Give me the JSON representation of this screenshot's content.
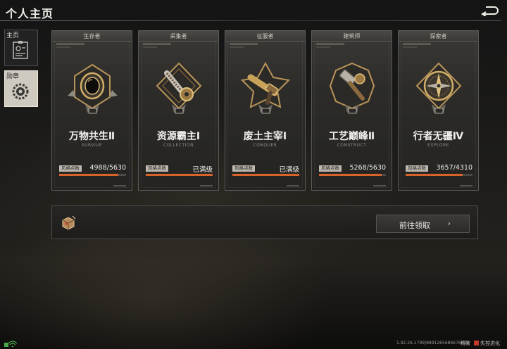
{
  "header": {
    "title": "个人主页"
  },
  "sidebar": {
    "items": [
      {
        "label": "主页",
        "icon": "profile-card-icon",
        "active": false
      },
      {
        "label": "勋章",
        "icon": "gear-badge-icon",
        "active": true
      }
    ]
  },
  "cards": [
    {
      "role": "生存者",
      "name": "万物共生Ⅱ",
      "subtitle": "SURVIVE",
      "points_label": "风格点数",
      "points": "4988/5630",
      "progress": 0.886,
      "medal": "astronaut-helmet-medal-icon",
      "rank": "Ⅱ"
    },
    {
      "role": "采集者",
      "name": "资源霸主Ⅰ",
      "subtitle": "COLLECTION",
      "points_label": "风格点数",
      "points": "已满级",
      "progress": 1.0,
      "medal": "chainsaw-medal-icon",
      "rank": "Ⅰ"
    },
    {
      "role": "征服者",
      "name": "废土主宰Ⅰ",
      "subtitle": "CONQUER",
      "points_label": "风格点数",
      "points": "已满级",
      "progress": 1.0,
      "medal": "revolver-medal-icon",
      "rank": "Ⅰ"
    },
    {
      "role": "建筑师",
      "name": "工艺巅峰Ⅱ",
      "subtitle": "CONSTRUCT",
      "points_label": "风格点数",
      "points": "5268/5630",
      "progress": 0.936,
      "medal": "hammer-medal-icon",
      "rank": "Ⅱ"
    },
    {
      "role": "探索者",
      "name": "行者无疆Ⅳ",
      "subtitle": "EXPLORE",
      "points_label": "风格点数",
      "points": "3657/4310",
      "progress": 0.848,
      "medal": "compass-medal-icon",
      "rank": "Ⅳ"
    }
  ],
  "reward": {
    "icon": "supply-box-icon",
    "button_label": "前往领取",
    "button_arrow": "›"
  },
  "status": {
    "version": "1.92.26.1799|8891265686676629",
    "perf_label": "精致",
    "logo_text": "失控进化"
  },
  "colors": {
    "progress": "#d8632a",
    "accent_gold": "#c9a25a",
    "card_bg": "#2d2c29"
  }
}
